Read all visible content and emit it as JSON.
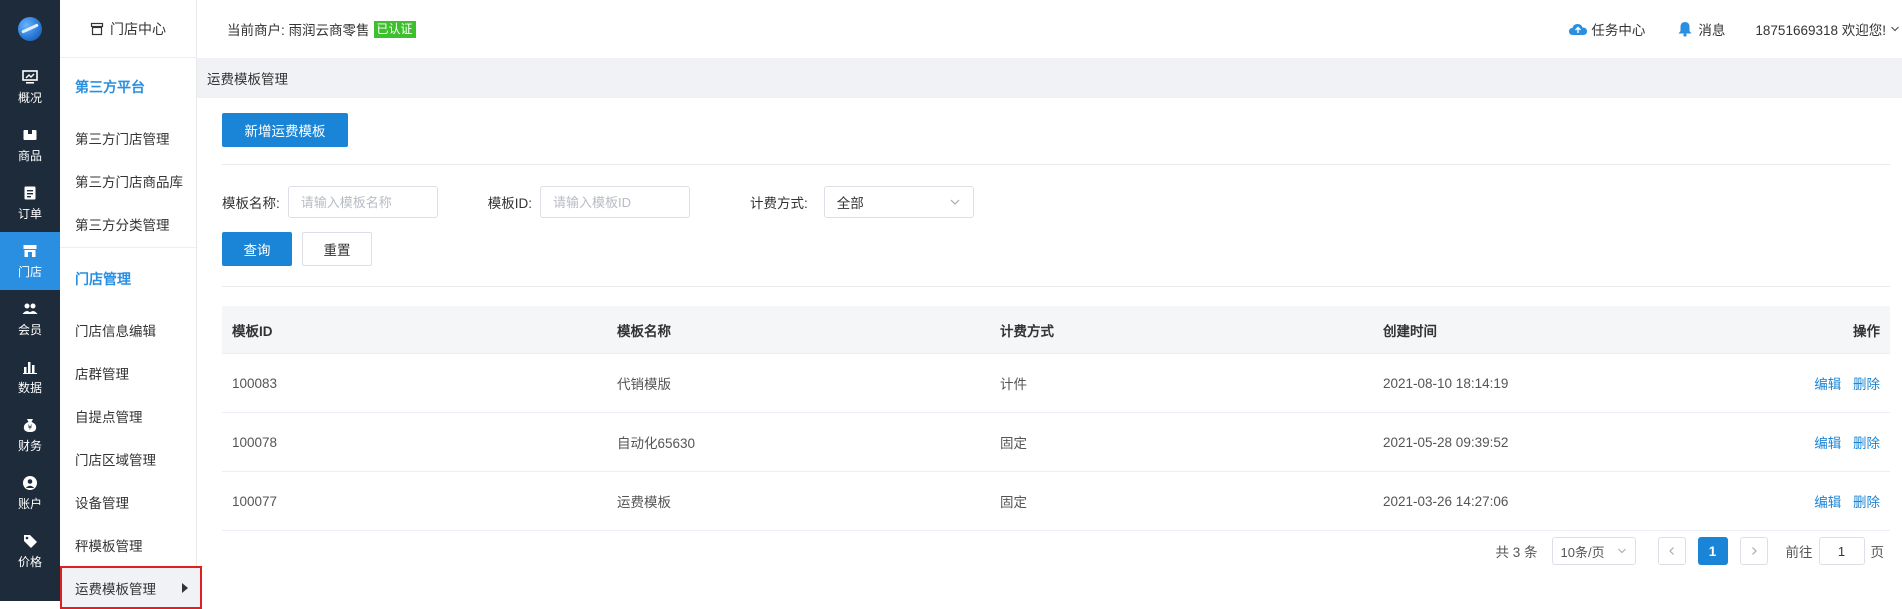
{
  "rail": {
    "items": [
      {
        "label": "概况",
        "icon": "monitor-icon"
      },
      {
        "label": "商品",
        "icon": "box-icon"
      },
      {
        "label": "订单",
        "icon": "clipboard-icon"
      },
      {
        "label": "门店",
        "icon": "store-icon",
        "active": true
      },
      {
        "label": "会员",
        "icon": "users-icon"
      },
      {
        "label": "数据",
        "icon": "bar-chart-icon"
      },
      {
        "label": "财务",
        "icon": "money-bag-icon"
      },
      {
        "label": "账户",
        "icon": "account-icon"
      },
      {
        "label": "价格",
        "icon": "price-tag-icon"
      }
    ]
  },
  "submenu": {
    "header": "门店中心",
    "groups": [
      {
        "title": "第三方平台",
        "items": [
          "第三方门店管理",
          "第三方门店商品库",
          "第三方分类管理"
        ]
      },
      {
        "title": "门店管理",
        "items": [
          "门店信息编辑",
          "店群管理",
          "自提点管理",
          "门店区域管理",
          "设备管理",
          "秤模板管理",
          "运费模板管理"
        ]
      }
    ]
  },
  "topbar": {
    "merchant_prefix": "当前商户: 雨润云商零售",
    "badge": "已认证",
    "task_center": "任务中心",
    "messages": "消息",
    "user": "18751669318 欢迎您!"
  },
  "breadcrumb": "运费模板管理",
  "main": {
    "add_button": "新增运费模板",
    "filters": {
      "name_label": "模板名称:",
      "name_placeholder": "请输入模板名称",
      "id_label": "模板ID:",
      "id_placeholder": "请输入模板ID",
      "billing_label": "计费方式:",
      "billing_value": "全部"
    },
    "query_button": "查询",
    "reset_button": "重置",
    "table": {
      "columns": [
        "模板ID",
        "模板名称",
        "计费方式",
        "创建时间",
        "操作"
      ],
      "rows": [
        {
          "id": "100083",
          "name": "代销模版",
          "billing": "计件",
          "created": "2021-08-10 18:14:19"
        },
        {
          "id": "100078",
          "name": "自动化65630",
          "billing": "固定",
          "created": "2021-05-28 09:39:52"
        },
        {
          "id": "100077",
          "name": "运费模板",
          "billing": "固定",
          "created": "2021-03-26 14:27:06"
        }
      ],
      "edit_label": "编辑",
      "delete_label": "删除"
    },
    "pagination": {
      "total": "共 3 条",
      "page_size": "10条/页",
      "current_page": "1",
      "goto_label": "前往",
      "goto_value": "1",
      "page_suffix": "页"
    }
  },
  "colors": {
    "primary": "#1a85d6",
    "rail_bg": "#1d2b3a",
    "badge": "#3ec02e",
    "highlight_border": "#e02020"
  }
}
